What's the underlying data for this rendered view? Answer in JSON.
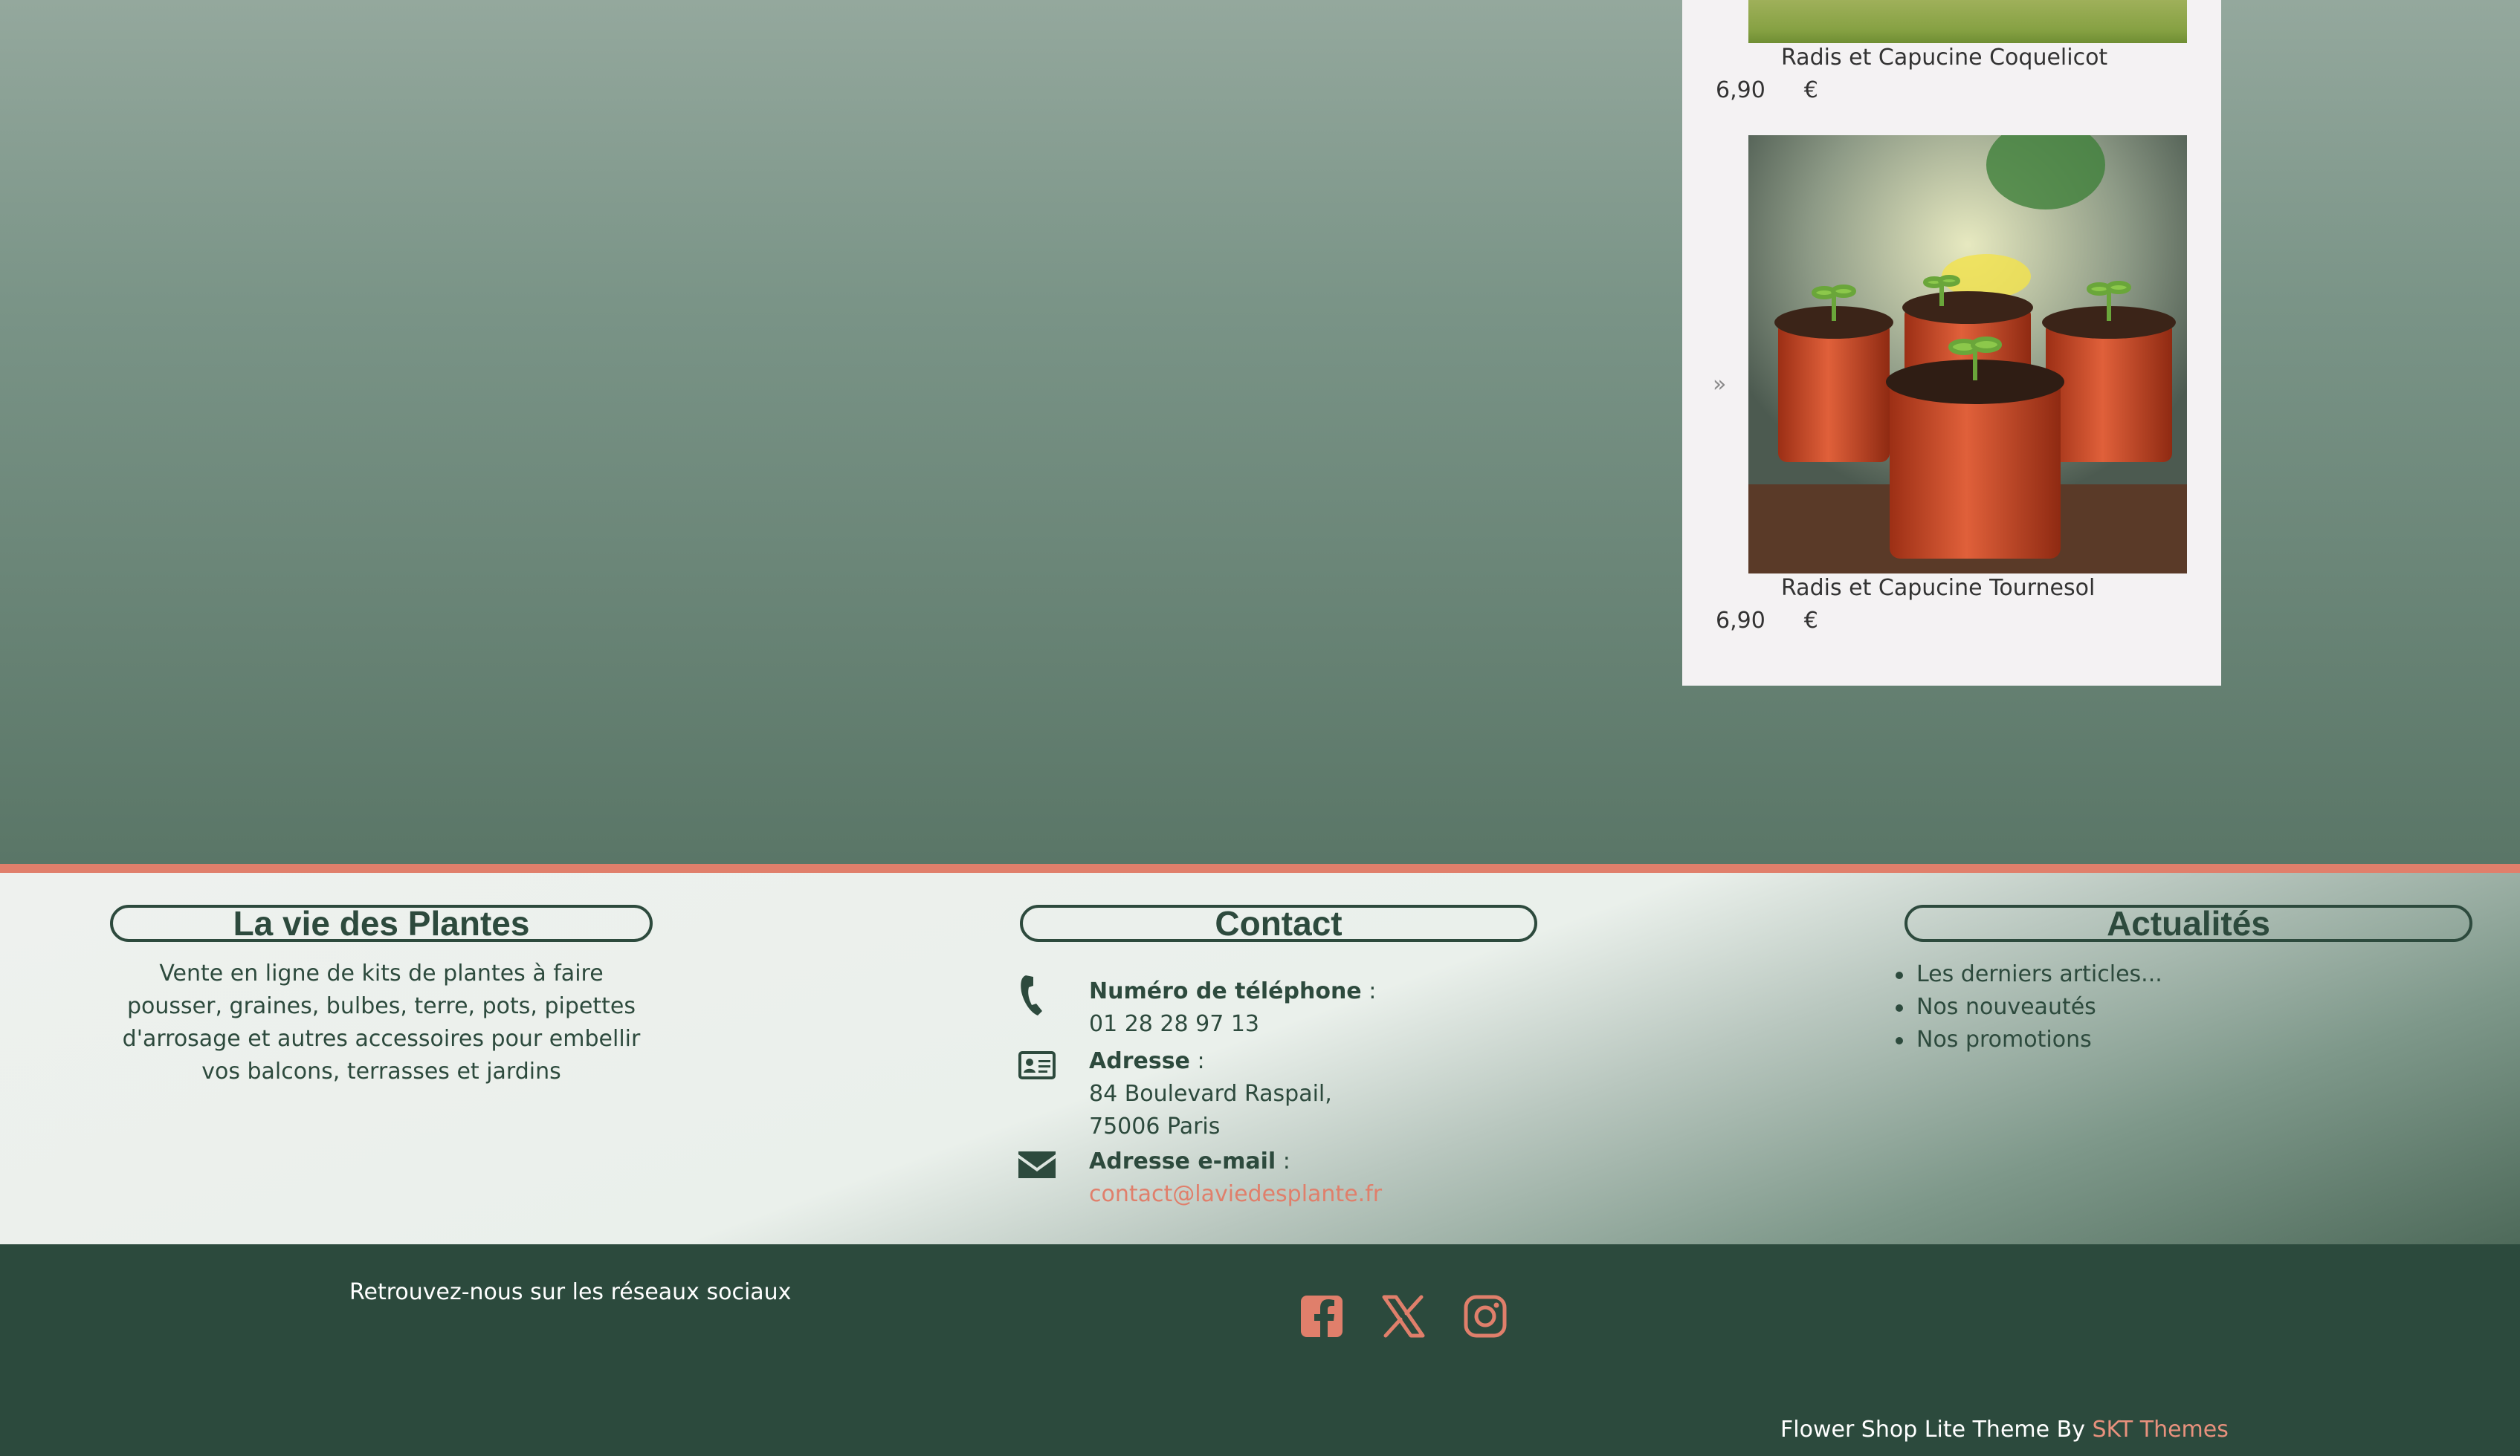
{
  "products": [
    {
      "name": "Radis et Capucine Coquelicot",
      "price": "6,90",
      "currency": "€"
    },
    {
      "name": "Radis et Capucine Tournesol",
      "price": "6,90",
      "currency": "€"
    }
  ],
  "carousel": {
    "next_symbol": "»"
  },
  "footer": {
    "about": {
      "title": "La vie des Plantes",
      "text": "Vente en ligne de kits de plantes à faire pousser, graines, bulbes, terre, pots, pipettes d'arrosage et autres accessoires pour embellir vos balcons, terrasses et jardins"
    },
    "contact": {
      "title": "Contact",
      "phone_label": "Numéro de téléphone",
      "phone_value": "01 28 28 97 13",
      "address_label": "Adresse",
      "address_line1": "84 Boulevard Raspail,",
      "address_line2": "75006 Paris",
      "email_label": "Adresse e-mail",
      "email_value": "contact@laviedesplante.fr",
      "colon": " :"
    },
    "news": {
      "title": "Actualités",
      "items": [
        "Les derniers articles...",
        "Nos nouveautés",
        "Nos promotions"
      ]
    }
  },
  "bottom_bar": {
    "social_text": "Retrouvez-nous sur les réseaux sociaux",
    "social_icons": [
      "facebook-icon",
      "x-twitter-icon",
      "instagram-icon"
    ],
    "credits_text": "Flower Shop Lite Theme By ",
    "credits_link": "SKT Themes"
  },
  "colors": {
    "accent": "#e07f6b",
    "dark_green": "#2c4a3d",
    "widget_bg": "#f4f2f3"
  }
}
